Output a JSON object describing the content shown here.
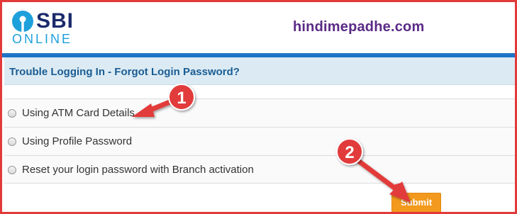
{
  "logo": {
    "brand": "SBI",
    "sub": "ONLINE"
  },
  "watermark": "hindimepadhe.com",
  "title": "Trouble Logging In - Forgot Login Password?",
  "options": [
    {
      "label": "Using ATM Card Details"
    },
    {
      "label": "Using Profile Password"
    },
    {
      "label": "Reset your login password with Branch activation"
    }
  ],
  "submit_label": "Submit",
  "annotations": {
    "badge1": "1",
    "badge2": "2"
  },
  "colors": {
    "frame": "#e23a3a",
    "brand_navy": "#1a2a6c",
    "brand_blue": "#1ea0db",
    "accent_bar": "#1f73c5",
    "title_bg": "#dcebf3",
    "title_text": "#1a5d94",
    "submit": "#f39a1e",
    "annotation": "#e23a3a"
  }
}
